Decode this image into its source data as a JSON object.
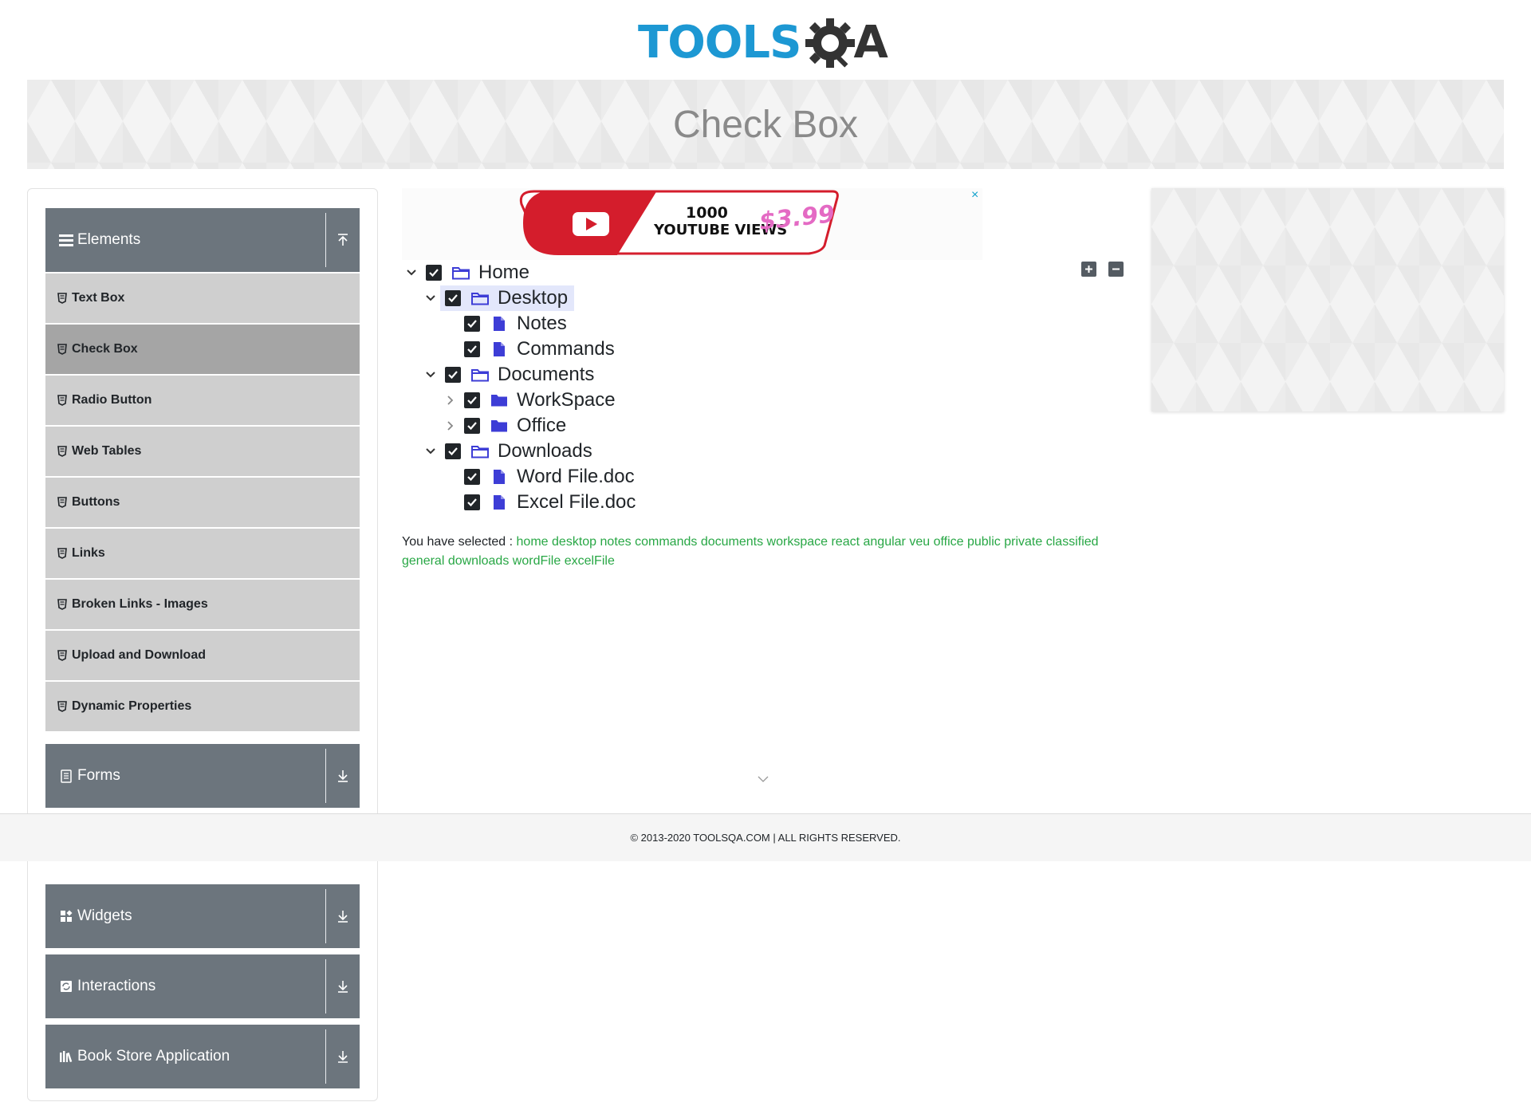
{
  "header": {
    "logo_text": "TOOLS",
    "logo_suffix": "A"
  },
  "banner": {
    "title": "Check Box"
  },
  "ad": {
    "line1": "1000",
    "line2": "YOUTUBE VIEWS",
    "price": "$3.99",
    "close_label": "×"
  },
  "sidebar": {
    "groups": [
      {
        "label": "Elements",
        "icon": "hamburger-icon",
        "toggle": "collapse-up-icon"
      },
      {
        "label": "Forms",
        "icon": "form-icon",
        "toggle": "expand-down-icon"
      },
      {
        "label": "Widgets",
        "icon": "widgets-icon",
        "toggle": "expand-down-icon"
      },
      {
        "label": "Interactions",
        "icon": "interactions-icon",
        "toggle": "expand-down-icon"
      },
      {
        "label": "Book Store Application",
        "icon": "book-icon",
        "toggle": "expand-down-icon"
      }
    ],
    "items": [
      {
        "label": "Text Box"
      },
      {
        "label": "Check Box",
        "active": true
      },
      {
        "label": "Radio Button"
      },
      {
        "label": "Web Tables"
      },
      {
        "label": "Buttons"
      },
      {
        "label": "Links"
      },
      {
        "label": "Broken Links - Images"
      },
      {
        "label": "Upload and Download"
      },
      {
        "label": "Dynamic Properties"
      }
    ]
  },
  "tree": {
    "nodes": [
      {
        "label": "Home",
        "type": "folder-open",
        "expanded": true,
        "checked": true
      },
      {
        "label": "Desktop",
        "type": "folder-open",
        "expanded": true,
        "checked": true,
        "highlighted": true
      },
      {
        "label": "Notes",
        "type": "file",
        "checked": true
      },
      {
        "label": "Commands",
        "type": "file",
        "checked": true
      },
      {
        "label": "Documents",
        "type": "folder-open",
        "expanded": true,
        "checked": true
      },
      {
        "label": "WorkSpace",
        "type": "folder-closed",
        "expanded": false,
        "checked": true
      },
      {
        "label": "Office",
        "type": "folder-closed",
        "expanded": false,
        "checked": true
      },
      {
        "label": "Downloads",
        "type": "folder-open",
        "expanded": true,
        "checked": true
      },
      {
        "label": "Word File.doc",
        "type": "file",
        "checked": true
      },
      {
        "label": "Excel File.doc",
        "type": "file",
        "checked": true
      }
    ],
    "expand_all_label": "+",
    "collapse_all_label": "−"
  },
  "result": {
    "prefix": "You have selected :",
    "selected": [
      "home",
      "desktop",
      "notes",
      "commands",
      "documents",
      "workspace",
      "react",
      "angular",
      "veu",
      "office",
      "public",
      "private",
      "classified",
      "general",
      "downloads",
      "wordFile",
      "excelFile"
    ]
  },
  "footer": {
    "text": "© 2013-2020 TOOLSQA.COM | ALL RIGHTS RESERVED."
  },
  "colors": {
    "accent_blue": "#1d98d3",
    "sidebar_header": "#6c757d",
    "sidebar_item": "#cfcfcf",
    "sidebar_item_active": "#a5a5a5",
    "tree_icon": "#3d3dd6",
    "selected_text": "#28a745"
  }
}
